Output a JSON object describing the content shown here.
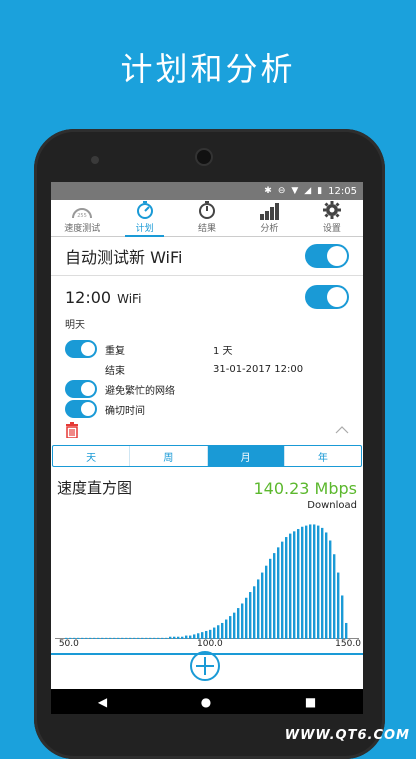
{
  "promo": {
    "title": "计划和分析"
  },
  "status": {
    "time": "12:05"
  },
  "tabs": [
    {
      "label": "速度测试",
      "icon": "speedometer-icon"
    },
    {
      "label": "计划",
      "icon": "stopwatch-icon"
    },
    {
      "label": "结果",
      "icon": "timer-icon"
    },
    {
      "label": "分析",
      "icon": "bar-chart-icon"
    },
    {
      "label": "设置",
      "icon": "gear-icon"
    }
  ],
  "auto_test": {
    "title": "自动测试新 WiFi"
  },
  "schedule": {
    "time": "12:00",
    "network": "WiFi",
    "day": "明天",
    "repeat_label": "重复",
    "repeat_value": "1 天",
    "end_label": "结束",
    "end_value": "31-01-2017 12:00",
    "avoid_busy_label": "避免繁忙的网络",
    "exact_time_label": "确切时间"
  },
  "segments": {
    "items": [
      "天",
      "周",
      "月",
      "年"
    ],
    "active": "月"
  },
  "histogram": {
    "title": "速度直方图",
    "speed": "140.23 Mbps",
    "direction": "Download"
  },
  "chart_data": {
    "type": "bar",
    "title": "速度直方图",
    "xlim": [
      45,
      155
    ],
    "x_ticks": [
      "50.0",
      "100.0",
      "150.0"
    ],
    "values": [
      1,
      1,
      1,
      1,
      1,
      1,
      1,
      1,
      1,
      1,
      1,
      1,
      1,
      1,
      1,
      1,
      1,
      1,
      1,
      1,
      1,
      1,
      1,
      1,
      1,
      1,
      2,
      2,
      2,
      2,
      3,
      3,
      4,
      5,
      6,
      7,
      8,
      10,
      12,
      14,
      17,
      20,
      23,
      27,
      31,
      36,
      41,
      46,
      52,
      58,
      64,
      70,
      75,
      80,
      85,
      89,
      92,
      94,
      96,
      98,
      99,
      100,
      100,
      99,
      97,
      93,
      86,
      74,
      58,
      38,
      14
    ],
    "ylim": [
      0,
      110
    ]
  },
  "colors": {
    "accent": "#1a9ad6",
    "speed_green": "#5cb82e",
    "background": "#1ba1dc"
  },
  "watermark": "WWW.QT6.COM"
}
